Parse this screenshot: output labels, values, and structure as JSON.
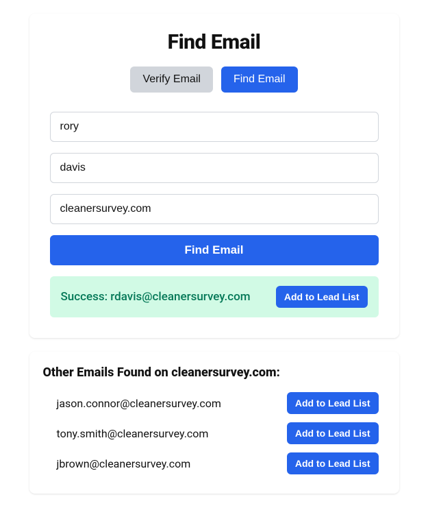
{
  "header": {
    "title": "Find Email"
  },
  "tabs": {
    "verify_label": "Verify Email",
    "find_label": "Find Email"
  },
  "form": {
    "first_name_value": "rory",
    "last_name_value": "davis",
    "domain_value": "cleanersurvey.com",
    "submit_label": "Find Email"
  },
  "result": {
    "success_text": "Success: rdavis@cleanersurvey.com",
    "add_label": "Add to Lead List"
  },
  "other": {
    "heading": "Other Emails Found on cleanersurvey.com:",
    "add_label_0": "Add to Lead List",
    "add_label_1": "Add to Lead List",
    "add_label_2": "Add to Lead List",
    "emails": [
      "jason.connor@cleanersurvey.com",
      "tony.smith@cleanersurvey.com",
      "jbrown@cleanersurvey.com"
    ]
  }
}
